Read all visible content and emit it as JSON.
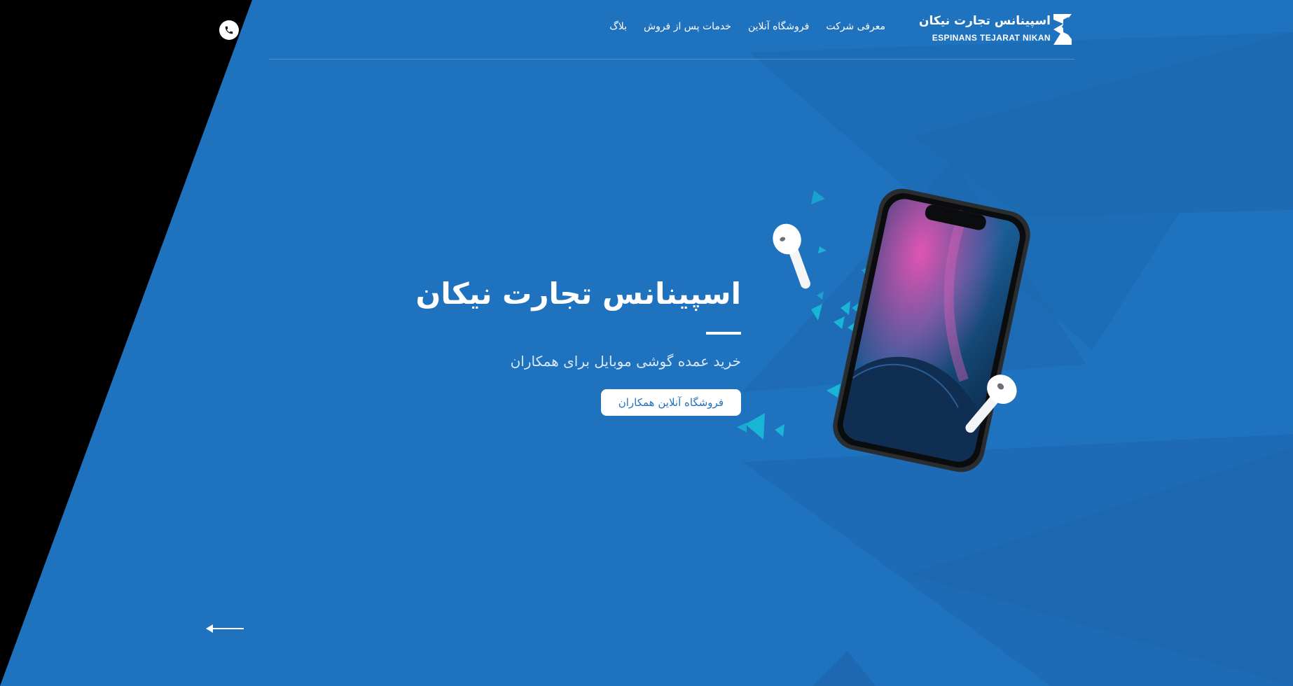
{
  "brand": {
    "name_fa": "اسپینانس تجارت نیکان",
    "name_en": "ESPINANS TEJARAT NIKAN",
    "logo_icon": "espinans-logo-icon"
  },
  "nav": {
    "items": [
      {
        "label": "معرفی شرکت"
      },
      {
        "label": "فروشگاه آنلاین"
      },
      {
        "label": "خدمات پس از فروش"
      },
      {
        "label": "بلاگ"
      }
    ]
  },
  "header": {
    "phone_icon": "phone-icon"
  },
  "hero": {
    "title": "اسپینانس تجارت نیکان",
    "subtitle": "خرید عمده گوشی موبایل برای همکاران",
    "cta_label": "فروشگاه آنلاین همکاران",
    "illustration_icon": "smartphone-airpods-illustration"
  },
  "slider": {
    "prev_icon": "arrow-left-icon"
  },
  "colors": {
    "background": "#1f72bd",
    "wedge": "#000000",
    "accent_cyan": "#19b5d6",
    "text": "#ffffff"
  }
}
